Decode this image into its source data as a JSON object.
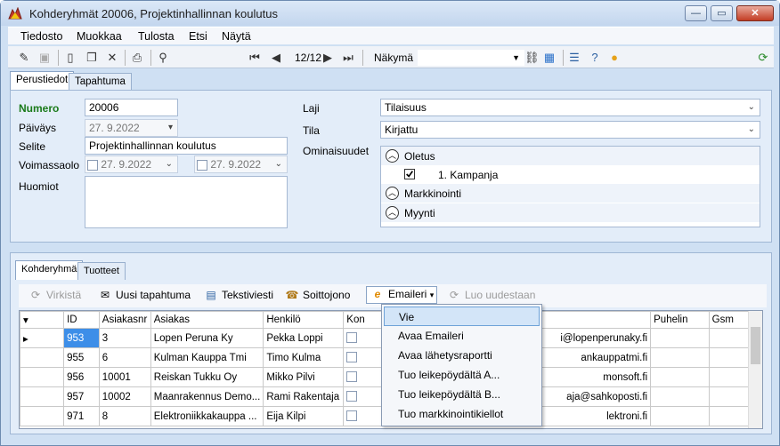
{
  "window": {
    "title": "Kohderyhmät 20006, Projektinhallinnan koulutus"
  },
  "menu": [
    "Tiedosto",
    "Muokkaa",
    "Tulosta",
    "Etsi",
    "Näytä"
  ],
  "toolbar": {
    "record_counter": "12/12",
    "view_label": "Näkymä"
  },
  "top_tabs": [
    "Perustiedot",
    "Tapahtuma"
  ],
  "form": {
    "numero_label": "Numero",
    "numero": "20006",
    "paivays_label": "Päiväys",
    "paivays": "27. 9.2022",
    "selite_label": "Selite",
    "selite": "Projektinhallinnan koulutus",
    "voimassaolo_label": "Voimassaolo",
    "voimassaolo_from": "27. 9.2022",
    "voimassaolo_to": "27. 9.2022",
    "huomiot_label": "Huomiot",
    "laji_label": "Laji",
    "laji": "Tilaisuus",
    "tila_label": "Tila",
    "tila": "Kirjattu",
    "ominaisuudet_label": "Ominaisuudet"
  },
  "ominaisuudet": {
    "groups": [
      "Oletus",
      "Markkinointi",
      "Myynti"
    ],
    "item": "1. Kampanja"
  },
  "bottom_tabs": [
    "Kohderyhmä",
    "Tuotteet"
  ],
  "toolbar2": {
    "virkista": "Virkistä",
    "uusi": "Uusi tapahtuma",
    "teksti": "Tekstiviesti",
    "soitto": "Soittojono",
    "emaileri": "Emaileri",
    "luo": "Luo uudestaan"
  },
  "grid": {
    "headers": [
      "",
      "ID",
      "Asiakasnr",
      "Asiakas",
      "Henkilö",
      "Kon",
      "",
      "Puhelin",
      "Gsm"
    ],
    "rows": [
      {
        "id": "953",
        "nr": "3",
        "asiakas": "Lopen Peruna Ky",
        "henkilo": "Pekka Loppi",
        "email": "i@lopenperunaky.fi"
      },
      {
        "id": "955",
        "nr": "6",
        "asiakas": "Kulman Kauppa Tmi",
        "henkilo": "Timo Kulma",
        "email": "ankauppatmi.fi"
      },
      {
        "id": "956",
        "nr": "10001",
        "asiakas": "Reiskan Tukku Oy",
        "henkilo": "Mikko Pilvi",
        "email": "monsoft.fi"
      },
      {
        "id": "957",
        "nr": "10002",
        "asiakas": "Maanrakennus Demo...",
        "henkilo": "Rami Rakentaja",
        "email": "aja@sahkoposti.fi"
      },
      {
        "id": "971",
        "nr": "8",
        "asiakas": "Elektroniikkakauppa ...",
        "henkilo": "Eija Kilpi",
        "email": "lektroni.fi"
      }
    ]
  },
  "dropdown": [
    "Vie",
    "Avaa Emaileri",
    "Avaa lähetysraportti",
    "Tuo leikepöydältä A...",
    "Tuo leikepöydältä B...",
    "Tuo markkinointikiellot"
  ]
}
